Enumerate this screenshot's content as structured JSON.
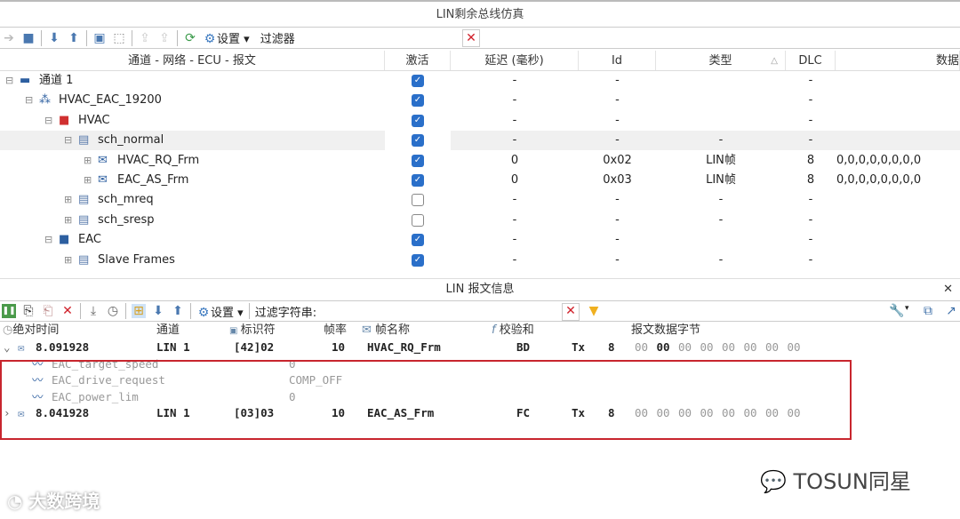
{
  "window_title": "LIN剩余总线仿真",
  "toolbar": {
    "settings": "设置",
    "filter": "过滤器"
  },
  "tree": {
    "columns": [
      "通道 - 网络 - ECU - 报文",
      "激活",
      "延迟 (毫秒)",
      "Id",
      "类型",
      "DLC",
      "数据"
    ],
    "rows": [
      {
        "label": "通道 1",
        "icon": "channel-icon",
        "active": true,
        "delay": "-",
        "id": "-",
        "type": "",
        "dlc": "-",
        "data": ""
      },
      {
        "label": "HVAC_EAC_19200",
        "icon": "network-icon",
        "active": true,
        "delay": "-",
        "id": "-",
        "type": "",
        "dlc": "-",
        "data": ""
      },
      {
        "label": "HVAC",
        "icon": "ecu-red-icon",
        "active": true,
        "delay": "-",
        "id": "-",
        "type": "",
        "dlc": "-",
        "data": ""
      },
      {
        "label": "sch_normal",
        "icon": "schedule-icon",
        "active": true,
        "delay": "-",
        "id": "-",
        "type": "-",
        "dlc": "-",
        "data": ""
      },
      {
        "label": "HVAC_RQ_Frm",
        "icon": "frame-send-icon",
        "active": true,
        "delay": "0",
        "id": "0x02",
        "type": "LIN帧",
        "dlc": "8",
        "data": "0,0,0,0,0,0,0,0"
      },
      {
        "label": "EAC_AS_Frm",
        "icon": "frame-icon",
        "active": true,
        "delay": "0",
        "id": "0x03",
        "type": "LIN帧",
        "dlc": "8",
        "data": "0,0,0,0,0,0,0,0"
      },
      {
        "label": "sch_mreq",
        "icon": "schedule-icon",
        "active": false,
        "delay": "-",
        "id": "-",
        "type": "-",
        "dlc": "-",
        "data": ""
      },
      {
        "label": "sch_sresp",
        "icon": "schedule-icon",
        "active": false,
        "delay": "-",
        "id": "-",
        "type": "-",
        "dlc": "-",
        "data": ""
      },
      {
        "label": "EAC",
        "icon": "ecu-blue-icon",
        "active": true,
        "delay": "-",
        "id": "-",
        "type": "",
        "dlc": "-",
        "data": ""
      },
      {
        "label": "Slave Frames",
        "icon": "schedule-icon",
        "active": true,
        "delay": "-",
        "id": "-",
        "type": "-",
        "dlc": "-",
        "data": ""
      }
    ]
  },
  "msg_panel": {
    "title": "LIN 报文信息",
    "settings": "设置",
    "filter_label": "过滤字符串:",
    "columns": [
      "绝对时间",
      "通道",
      "标识符",
      "帧率",
      "帧名称",
      "校验和",
      "报文数据字节"
    ],
    "rows": [
      {
        "time": "8.091928",
        "channel": "LIN 1",
        "ident": "[42]02",
        "rate": "10",
        "name": "HVAC_RQ_Frm",
        "checksum": "BD",
        "dir": "Tx",
        "dlc": "8",
        "bytes": [
          "00",
          "00",
          "00",
          "00",
          "00",
          "00",
          "00",
          "00"
        ],
        "expanded": true,
        "signals": [
          {
            "name": "EAC_target_speed",
            "value": "0"
          },
          {
            "name": "EAC_drive_request",
            "value": "COMP_OFF"
          },
          {
            "name": "EAC_power_lim",
            "value": "0"
          }
        ]
      },
      {
        "time": "8.041928",
        "channel": "LIN 1",
        "ident": "[03]03",
        "rate": "10",
        "name": "EAC_AS_Frm",
        "checksum": "FC",
        "dir": "Tx",
        "dlc": "8",
        "bytes": [
          "00",
          "00",
          "00",
          "00",
          "00",
          "00",
          "00",
          "00"
        ],
        "expanded": false,
        "signals": []
      }
    ]
  },
  "watermarks": {
    "left": "大数跨境",
    "right": "TOSUN同星"
  },
  "colors": {
    "accent": "#2a6fc9",
    "highlight_box": "#c8262e",
    "close_red": "#d0202a"
  }
}
